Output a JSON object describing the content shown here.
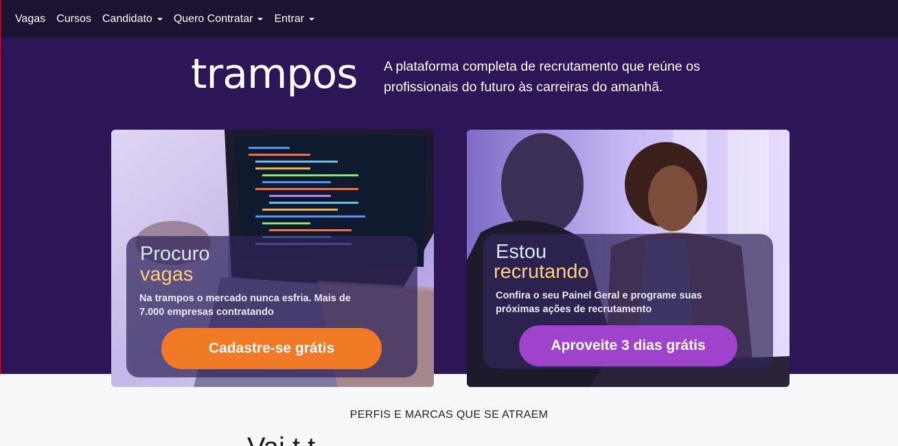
{
  "nav": {
    "items": [
      {
        "label": "Vagas",
        "dropdown": false
      },
      {
        "label": "Cursos",
        "dropdown": false
      },
      {
        "label": "Candidato",
        "dropdown": true
      },
      {
        "label": "Quero Contratar",
        "dropdown": true
      },
      {
        "label": "Entrar",
        "dropdown": true
      }
    ]
  },
  "hero": {
    "logo": "trampos",
    "tagline": "A plataforma completa de recrutamento que reúne os profissionais do futuro às carreiras do amanhã."
  },
  "cards": {
    "candidate": {
      "title_line1": "Procuro",
      "title_line2": "vagas",
      "description": "Na trampos o mercado nunca esfria. Mais de 7.000 empresas contratando",
      "button": "Cadastre-se grátis"
    },
    "recruiter": {
      "title_line1": "Estou",
      "title_line2": "recrutando",
      "description": "Confira o seu Painel Geral e programe suas próximas ações de recrutamento",
      "button": "Aproveite 3 dias grátis"
    }
  },
  "section": {
    "kicker": "PERFIS E MARCAS QUE SE ATRAEM",
    "heading_partial": "Vai                              t   t"
  },
  "colors": {
    "nav_bg": "#1e1233",
    "hero_bg": "#2c1657",
    "orange_button": "#f07a26",
    "purple_button": "#a043cc",
    "accent_yellow": "#ffce7a"
  }
}
